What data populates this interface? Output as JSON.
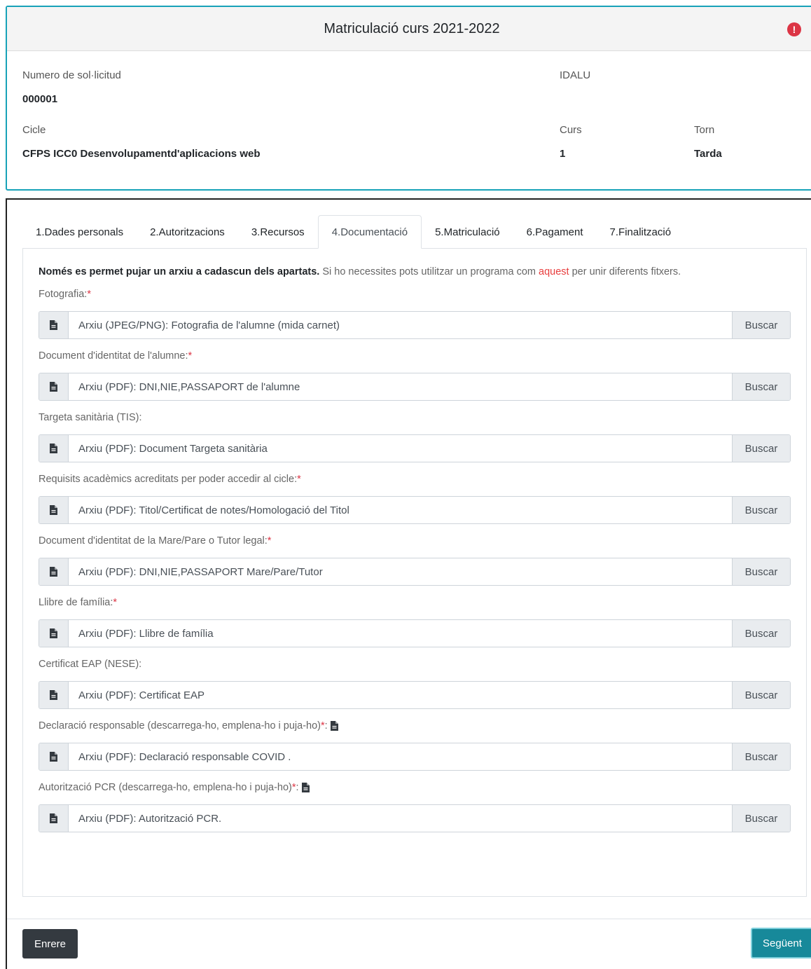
{
  "header": {
    "title": "Matriculació curs 2021-2022",
    "alert_icon": "exclamation-circle-icon",
    "alert_glyph": "!",
    "alert_color": "#dc3545",
    "request_number_label": "Numero de sol·licitud",
    "request_number_value": "000001",
    "idalu_label": "IDALU",
    "idalu_value": "",
    "cycle_label": "Cicle",
    "cycle_value": "CFPS ICC0 Desenvolupamentd'aplicacions web",
    "course_label": "Curs",
    "course_value": "1",
    "shift_label": "Torn",
    "shift_value": "Tarda"
  },
  "tabs": [
    {
      "label": "1.Dades personals",
      "active": false
    },
    {
      "label": "2.Autoritzacions",
      "active": false
    },
    {
      "label": "3.Recursos",
      "active": false
    },
    {
      "label": "4.Documentació",
      "active": true
    },
    {
      "label": "5.Matriculació",
      "active": false
    },
    {
      "label": "6.Pagament",
      "active": false
    },
    {
      "label": "7.Finalització",
      "active": false
    }
  ],
  "notice": {
    "bold": "Només es permet pujar un arxiu a cadascun dels apartats.",
    "text_before_link": " Si ho necessites pots utilitzar un programa com ",
    "link": "aquest",
    "text_after_link": " per unir diferents fitxers."
  },
  "fields": [
    {
      "label": "Fotografia:",
      "required": "*",
      "download": false,
      "placeholder": "Arxiu (JPEG/PNG): Fotografia de l'alumne (mida carnet)",
      "button": "Buscar"
    },
    {
      "label": "Document d'identitat de l'alumne:",
      "required": "*",
      "download": false,
      "placeholder": "Arxiu (PDF): DNI,NIE,PASSAPORT de l'alumne",
      "button": "Buscar"
    },
    {
      "label": "Targeta sanitària (TIS):",
      "required": "",
      "download": false,
      "placeholder": "Arxiu (PDF): Document Targeta sanitària",
      "button": "Buscar"
    },
    {
      "label": "Requisits acadèmics acreditats per poder accedir al cicle:",
      "required": "*",
      "download": false,
      "placeholder": "Arxiu (PDF): Titol/Certificat de notes/Homologació del Titol",
      "button": "Buscar"
    },
    {
      "label": "Document d'identitat de la Mare/Pare o Tutor legal:",
      "required": "*",
      "download": false,
      "placeholder": "Arxiu (PDF): DNI,NIE,PASSAPORT Mare/Pare/Tutor",
      "button": "Buscar"
    },
    {
      "label": "Llibre de família:",
      "required": "*",
      "download": false,
      "placeholder": "Arxiu (PDF): Llibre de família",
      "button": "Buscar"
    },
    {
      "label": "Certificat EAP (NESE):",
      "required": "",
      "download": false,
      "placeholder": "Arxiu (PDF): Certificat EAP",
      "button": "Buscar"
    },
    {
      "label": "Declaració responsable (descarrega-ho, emplena-ho i puja-ho)",
      "required": "*",
      "suffix": ":",
      "download": true,
      "placeholder": "Arxiu (PDF): Declaració responsable COVID .",
      "button": "Buscar"
    },
    {
      "label": "Autorització PCR (descarrega-ho, emplena-ho i puja-ho)",
      "required": "*",
      "suffix": ":",
      "download": true,
      "placeholder": "Arxiu (PDF): Autorització PCR.",
      "button": "Buscar"
    }
  ],
  "footer": {
    "back_label": "Enrere",
    "next_label": "Següent"
  },
  "colors": {
    "accent": "#17a2b8",
    "next_button": "#17899a",
    "back_button": "#343a40",
    "required": "#dc3545"
  }
}
